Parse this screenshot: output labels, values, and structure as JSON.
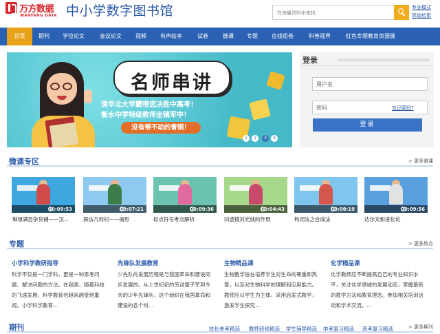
{
  "header": {
    "brand_cn": "万方数据",
    "brand_en": "WANFANG DATA",
    "site_title": "中小学数字图书馆",
    "search_placeholder": "在海量资料中查找",
    "mode_links": [
      "专业模式",
      "高级检索"
    ]
  },
  "nav": {
    "items": [
      "首页",
      "期刊",
      "学位论文",
      "会议论文",
      "视频",
      "有声绘本",
      "试卷",
      "微课",
      "专题",
      "在线组卷",
      "科普视界",
      "红色专题教育资源展"
    ],
    "active_index": 0
  },
  "banner": {
    "title": "名师串讲",
    "line1": "清华北大学霸带您决胜中高考！",
    "line2": "衡水中学特级教师坐镇军中！",
    "pill": "没有带不动的青铜！",
    "dots": [
      "1",
      "2",
      "3",
      "4"
    ],
    "active_dot": 3
  },
  "login": {
    "title": "登录",
    "username_placeholder": "用户名",
    "password_placeholder": "密码",
    "forgot": "忘记密码?",
    "button": "登录"
  },
  "micro": {
    "title": "微课专区",
    "more": "> 更多微课",
    "videos": [
      {
        "duration": "00:09:53",
        "title": "琳琅满目杂货铺——汉...",
        "color": "#3fa7e0"
      },
      {
        "duration": "00:07:21",
        "title": "探访几何村——扇形",
        "color": "#8ec9ef"
      },
      {
        "duration": "00:09:36",
        "title": "标点符号考点解析",
        "color": "#6cc3b0"
      },
      {
        "duration": "00:04:43",
        "title": "凹透镜对光线的作用",
        "color": "#a7d98a"
      },
      {
        "duration": "00:08:19",
        "title": "构词法之合成法",
        "color": "#7fc6ee"
      },
      {
        "duration": "00:09:56",
        "title": "达尔文和进化论",
        "color": "#5aa0dc"
      }
    ]
  },
  "topics": {
    "title": "专题",
    "more": "> 更多热点",
    "columns": [
      {
        "title": "小学科学教研指导",
        "text": "科学不仅是一门学科，更是一种思考问题、解决问题的方法。在我国，随着科技的飞速发展，科学教育也越来越受到重视。小学科学教育..."
      },
      {
        "title": "先锋队发展教育",
        "text": "少先队的发展历程是与我国革命和建设同步发展的。从上世纪初的劳动童子军到今天的少年先锋队，这个组织在我国革命和建设的各个时..."
      },
      {
        "title": "生物精品课",
        "text": "生物教学旨在培养学生对生命的尊重和热爱，以及对生物科学的理解和应用能力。教师应以学生为主体，采用启发式教学，激发学生探究..."
      },
      {
        "title": "化学精品课",
        "text": "化学教师应不断提高自己的专业知识水平，关注化学领域的发展动态，掌握最新的教学方法和教育理念。参加相关培训活动和学术交流，..."
      }
    ]
  },
  "journals": {
    "title": "期刊",
    "links": [
      "校长参考精选",
      "教师研修精选",
      "学生辅导精选",
      "中考复习精选",
      "高考复习精选"
    ],
    "more": "> 更多期刊"
  }
}
